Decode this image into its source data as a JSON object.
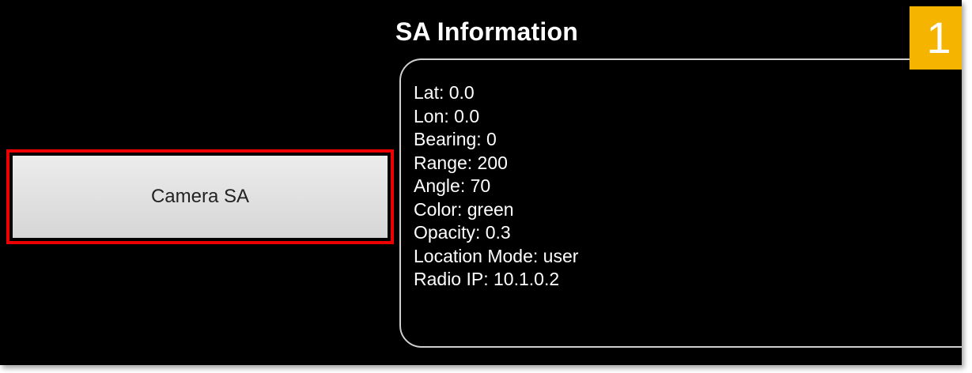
{
  "camera_button": {
    "label": "Camera SA"
  },
  "sa_info": {
    "title": "SA Information",
    "lines": [
      "Lat: 0.0",
      "Lon: 0.0",
      "Bearing: 0",
      "Range: 200",
      "Angle: 70",
      "Color: green",
      "Opacity: 0.3",
      "Location Mode: user",
      "Radio IP: 10.1.0.2"
    ]
  },
  "callout": {
    "number": "1"
  },
  "colors": {
    "background": "#000000",
    "highlight_border": "#ee0000",
    "callout_badge": "#f5b400",
    "button_face": "#dddddd",
    "text": "#ffffff"
  }
}
